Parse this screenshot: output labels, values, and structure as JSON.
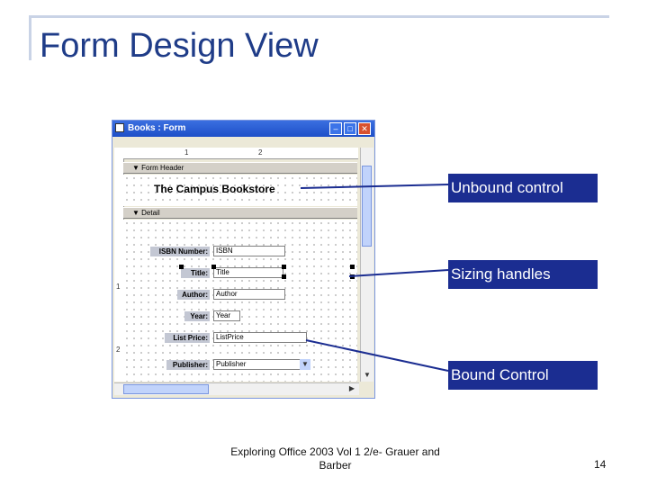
{
  "slide": {
    "title": "Form Design View",
    "footer": "Exploring Office 2003 Vol 1 2/e- Grauer and Barber",
    "page_number": "14"
  },
  "window": {
    "title": "Books : Form",
    "buttons": [
      "minimize",
      "maximize",
      "close"
    ]
  },
  "ruler": {
    "top_marks": [
      "1",
      "2"
    ],
    "left_marks": [
      "1",
      "2"
    ]
  },
  "sections": {
    "header": "Form Header",
    "detail": "Detail"
  },
  "header_label": "The Campus Bookstore",
  "fields": [
    {
      "label": "ISBN Number:",
      "value": "ISBN"
    },
    {
      "label": "Title:",
      "value": "Title"
    },
    {
      "label": "Author:",
      "value": "Author"
    },
    {
      "label": "Year:",
      "value": "Year"
    },
    {
      "label": "List Price:",
      "value": "ListPrice"
    },
    {
      "label": "Publisher:",
      "value": "Publisher"
    }
  ],
  "callouts": {
    "unbound": "Unbound control",
    "sizing": "Sizing handles",
    "bound": "Bound Control"
  },
  "colors": {
    "title": "#1f3c88",
    "callout_bg": "#1b2d91",
    "line": "#1b2d91"
  }
}
